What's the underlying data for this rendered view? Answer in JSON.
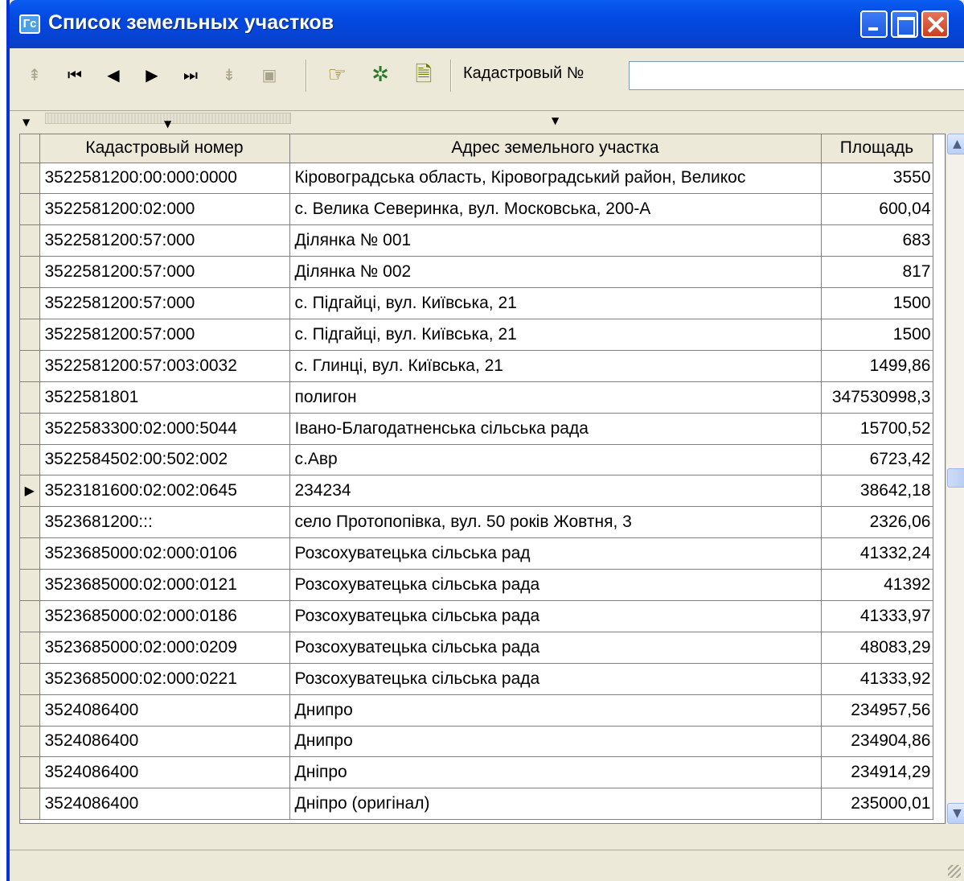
{
  "window": {
    "icon_text": "Гс",
    "title": "Список земельных участков"
  },
  "toolbar": {
    "nav_buttons": [
      {
        "name": "insert-record-icon",
        "glyph": "⇞",
        "enabled": false
      },
      {
        "name": "first-record-icon",
        "glyph": "⏮",
        "enabled": true
      },
      {
        "name": "prior-record-icon",
        "glyph": "◀",
        "enabled": true
      },
      {
        "name": "next-record-icon",
        "glyph": "▶",
        "enabled": true
      },
      {
        "name": "last-record-icon",
        "glyph": "⏭",
        "enabled": true
      },
      {
        "name": "delete-record-icon",
        "glyph": "⇟",
        "enabled": false
      },
      {
        "name": "post-record-icon",
        "glyph": "▣",
        "enabled": false
      }
    ],
    "search_label": "Кадастровый №",
    "search_value": ""
  },
  "table": {
    "columns": [
      "Кадастровый номер",
      "Адрес земельного участка",
      "Площадь"
    ],
    "current_row": 10,
    "rows": [
      [
        "3522581200:00:000:0000",
        "Кіровоградська область, Кіровоградський район, Великос",
        "3550"
      ],
      [
        "3522581200:02:000",
        "с. Велика Северинка, вул. Московська, 200-А",
        "600,04"
      ],
      [
        "3522581200:57:000",
        "Ділянка № 001",
        "683"
      ],
      [
        "3522581200:57:000",
        "Ділянка № 002",
        "817"
      ],
      [
        "3522581200:57:000",
        "с. Підгайці, вул. Київська, 21",
        "1500"
      ],
      [
        "3522581200:57:000",
        "с. Підгайці, вул. Київська, 21",
        "1500"
      ],
      [
        "3522581200:57:003:0032",
        "с. Глинці, вул. Київська, 21",
        "1499,86"
      ],
      [
        "3522581801",
        "полигон",
        "347530998,3"
      ],
      [
        "3522583300:02:000:5044",
        "Івано-Благодатненська сільська рада",
        "15700,52"
      ],
      [
        "3522584502:00:502:002",
        "с.Авр",
        "6723,42"
      ],
      [
        "3523181600:02:002:0645",
        "234234",
        "38642,18"
      ],
      [
        "3523681200:::",
        "село Протопопівка, вул. 50 років Жовтня, 3",
        "2326,06"
      ],
      [
        "3523685000:02:000:0106",
        "Розсохуватецька сільська рад",
        "41332,24"
      ],
      [
        "3523685000:02:000:0121",
        "Розсохуватецька сільська рада",
        "41392"
      ],
      [
        "3523685000:02:000:0186",
        "Розсохуватецька сільська рада",
        "41333,97"
      ],
      [
        "3523685000:02:000:0209",
        "Розсохуватецька сільська рада",
        "48083,29"
      ],
      [
        "3523685000:02:000:0221",
        "Розсохуватецька сільська рада",
        "41333,92"
      ],
      [
        "3524086400",
        "Днипро",
        "234957,56"
      ],
      [
        "3524086400",
        "Днипро",
        "234904,86"
      ],
      [
        "3524086400",
        "Дніпро",
        "234914,29"
      ],
      [
        "3524086400",
        "Дніпро (оригінал)",
        "235000,01"
      ]
    ]
  }
}
